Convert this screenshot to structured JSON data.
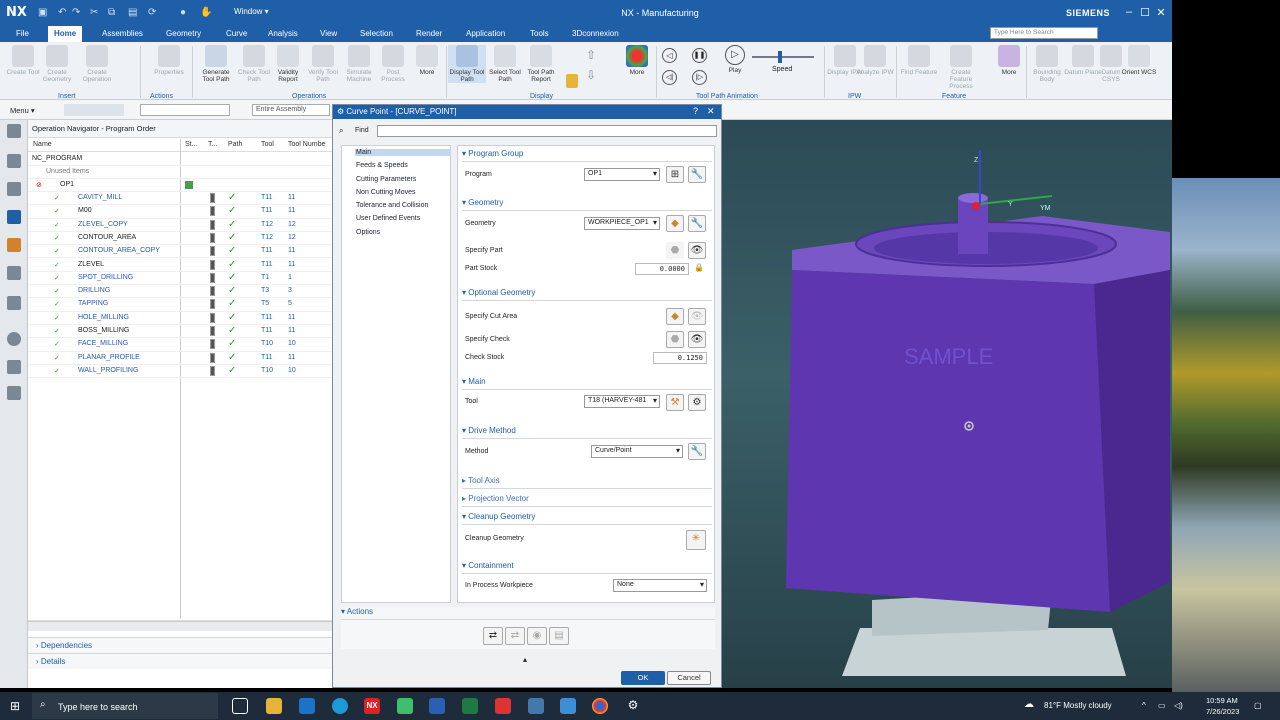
{
  "titlebar": {
    "logo": "NX",
    "window_menu": "Window ▾",
    "title": "NX - Manufacturing",
    "brand": "SIEMENS"
  },
  "menubar": {
    "tabs": [
      "File",
      "Home",
      "Assemblies",
      "Geometry",
      "Curve",
      "Analysis",
      "View",
      "Selection",
      "Render",
      "Application",
      "Tools",
      "3Dconnexion"
    ],
    "active": "Home",
    "search_placeholder": "Type Here to Search"
  },
  "ribbon": {
    "insert": [
      "Create Tool",
      "Create Geometry",
      "Create Operation"
    ],
    "actions": [
      "Properties"
    ],
    "operations": [
      "Generate Tool Path",
      "Check Tool Path",
      "Validity Report",
      "Verify Tool Path",
      "Simulate Machine",
      "Post Process",
      "More"
    ],
    "display": [
      "Display Tool Path",
      "Select Tool Path",
      "Tool Path Report"
    ],
    "animation": [
      "Play"
    ],
    "speed_label": "Speed",
    "ipw": [
      "Display IPW",
      "Analyze IPW"
    ],
    "feature": [
      "Find Feature",
      "Create Feature Process",
      "More"
    ],
    "right": [
      "Bounding Body",
      "Datum Plane",
      "Datum CSYS",
      "Orient WCS"
    ],
    "groups": [
      "Insert",
      "Actions",
      "Operations",
      "Display",
      "Tool Path Animation",
      "IPW",
      "Feature"
    ]
  },
  "toolbar2": {
    "menu": "Menu ▾",
    "assembly": "Entire Assembly"
  },
  "navigator": {
    "title": "Operation Navigator - Program Order",
    "columns": [
      "Name",
      "St...",
      "T...",
      "Path",
      "Tool",
      "Tool Numbe"
    ],
    "root": "NC_PROGRAM",
    "unused": "Unused Items",
    "program": "OP1",
    "ops": [
      {
        "name": "CAVITY_MILL",
        "tool": "T11",
        "num": "11",
        "style": "blue"
      },
      {
        "name": "M00",
        "tool": "T11",
        "num": "11",
        "style": "blk"
      },
      {
        "name": "ZLEVEL_COPY",
        "tool": "T12",
        "num": "12",
        "style": "blue"
      },
      {
        "name": "CONTOUR_AREA",
        "tool": "T12",
        "num": "12",
        "style": "blk"
      },
      {
        "name": "CONTOUR_AREA_COPY",
        "tool": "T11",
        "num": "11",
        "style": "blue"
      },
      {
        "name": "ZLEVEL",
        "tool": "T11",
        "num": "11",
        "style": "blk"
      },
      {
        "name": "SPOT_DRILLING",
        "tool": "T1",
        "num": "1",
        "style": "blue"
      },
      {
        "name": "DRILLING",
        "tool": "T3",
        "num": "3",
        "style": "blue"
      },
      {
        "name": "TAPPING",
        "tool": "T5",
        "num": "5",
        "style": "blue"
      },
      {
        "name": "HOLE_MILLING",
        "tool": "T11",
        "num": "11",
        "style": "blue"
      },
      {
        "name": "BOSS_MILLING",
        "tool": "T11",
        "num": "11",
        "style": "blk"
      },
      {
        "name": "FACE_MILLING",
        "tool": "T10",
        "num": "10",
        "style": "blue"
      },
      {
        "name": "PLANAR_PROFILE",
        "tool": "T11",
        "num": "11",
        "style": "blue"
      },
      {
        "name": "WALL_PROFILING",
        "tool": "T10",
        "num": "10",
        "style": "blue"
      }
    ],
    "sections": [
      "Dependencies",
      "Details"
    ]
  },
  "dialog": {
    "title": "Curve Point - [CURVE_POINT]",
    "find": "Find",
    "tree": [
      "Main",
      "Feeds & Speeds",
      "Cutting Parameters",
      "Non Cutting Moves",
      "Tolerance and Collision",
      "User Defined Events",
      "Options"
    ],
    "program_group": "Program Group",
    "program_label": "Program",
    "program_value": "OP1",
    "geometry": "Geometry",
    "geometry_label": "Geometry",
    "geometry_value": "WORKPIECE_OP1",
    "specify_part": "Specify Part",
    "part_stock": "Part Stock",
    "part_stock_value": "0.0000",
    "optional_geometry": "Optional Geometry",
    "specify_cut_area": "Specify Cut Area",
    "specify_check": "Specify Check",
    "check_stock": "Check Stock",
    "check_stock_value": "0.1250",
    "main": "Main",
    "tool_label": "Tool",
    "tool_value": "T18 (HARVEY-481",
    "drive_method": "Drive Method",
    "method_label": "Method",
    "method_value": "Curve/Point",
    "tool_axis": "Tool Axis",
    "projection_vector": "Projection Vector",
    "cleanup_geometry": "Cleanup Geometry",
    "cleanup_label": "Cleanup Geometry",
    "containment": "Containment",
    "ipw_label": "In Process Workpiece",
    "ipw_value": "None",
    "actions": "Actions",
    "ok": "OK",
    "cancel": "Cancel"
  },
  "viewport": {
    "axis_z": "Z",
    "axis_y": "Y",
    "axis_ym": "YM",
    "watermark": "SAMPLE",
    "part_color": "#6a3fb5"
  },
  "taskbar": {
    "search": "Type here to search",
    "weather": "81°F  Mostly cloudy",
    "time": "10:59 AM",
    "date": "7/26/2023"
  }
}
